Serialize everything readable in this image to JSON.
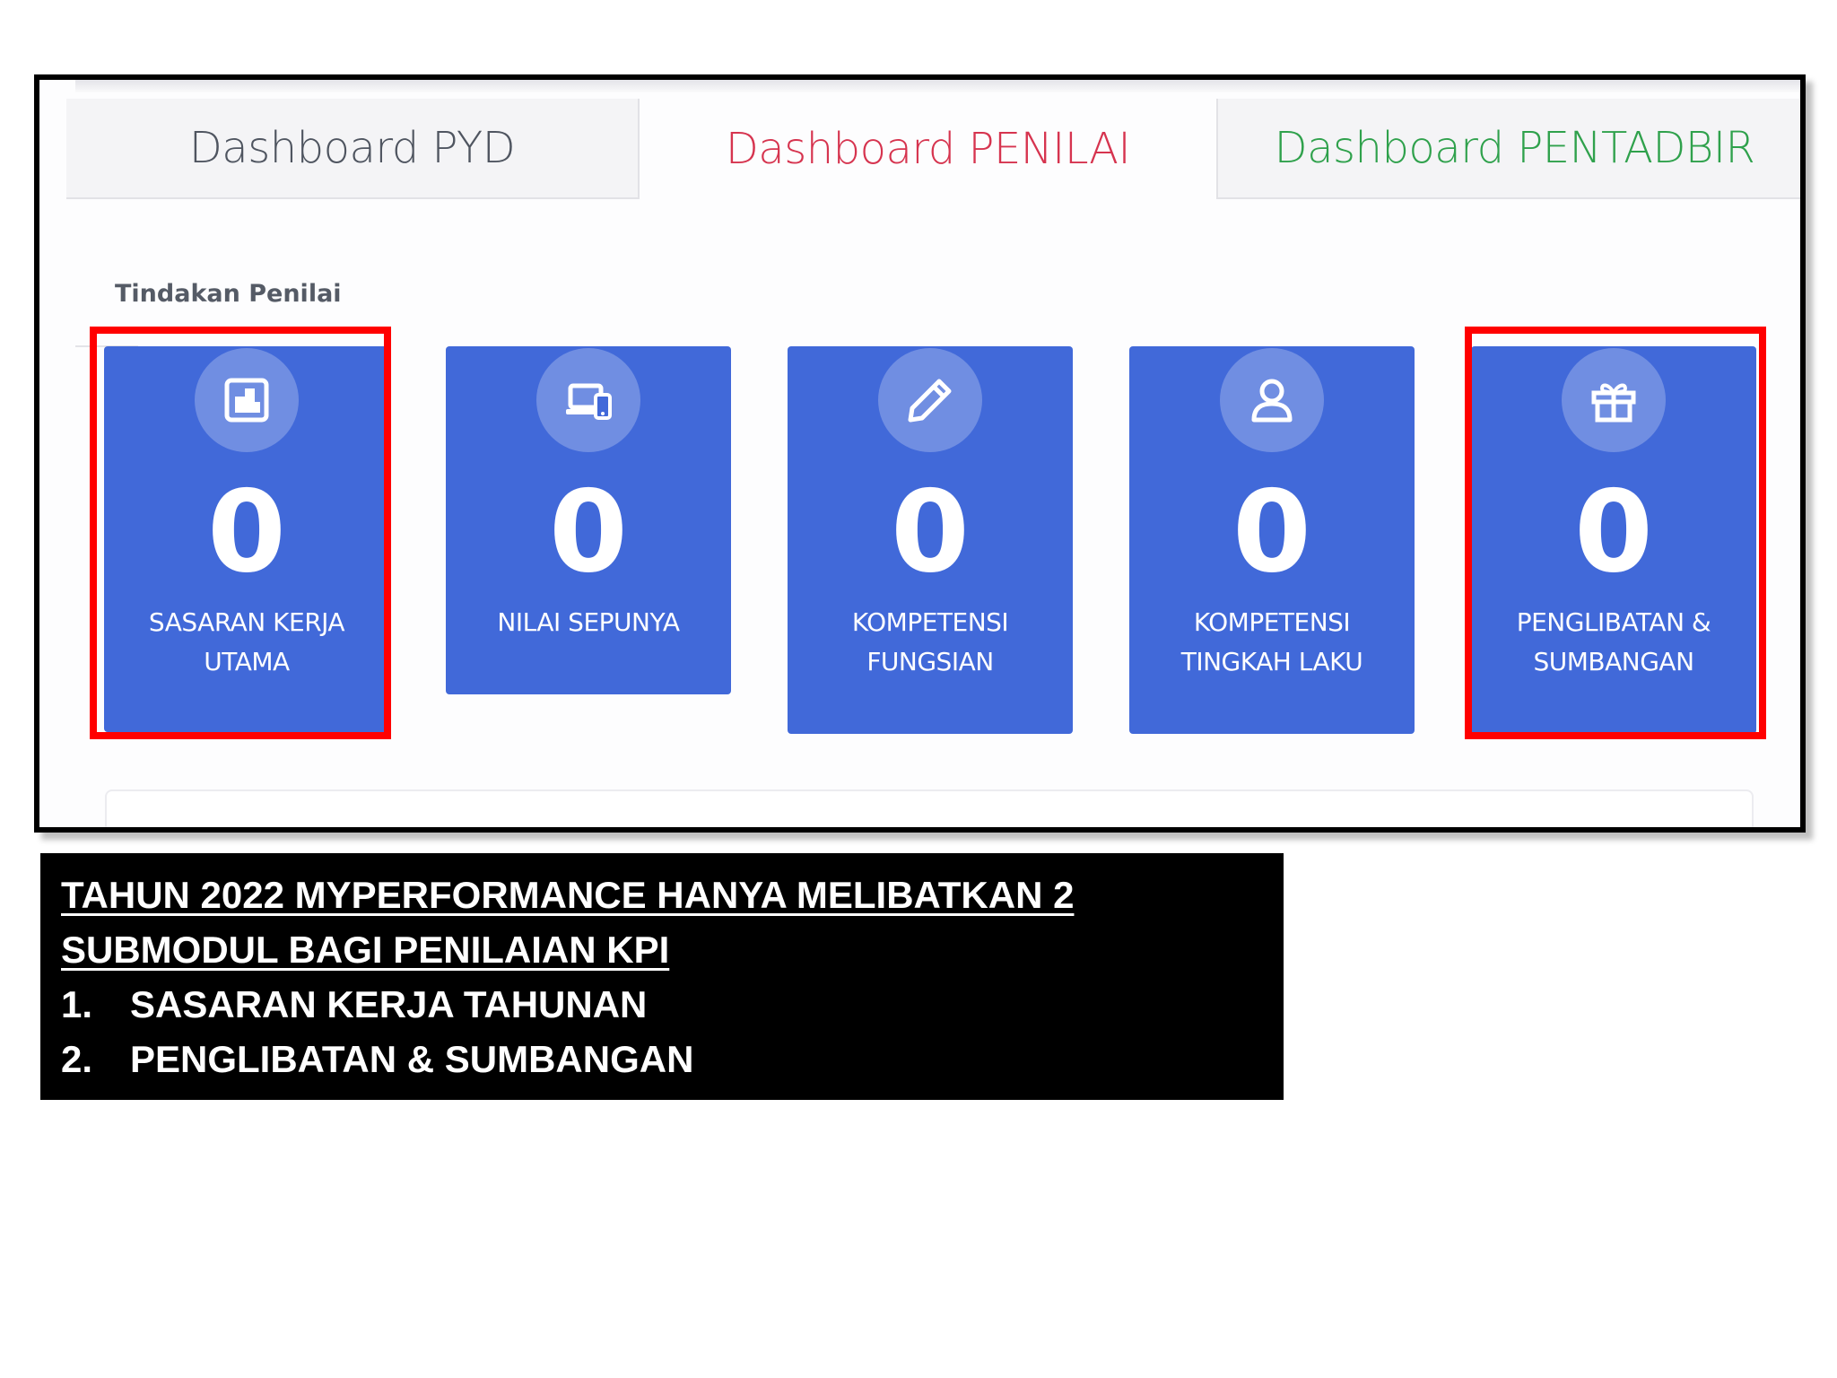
{
  "tabs": [
    {
      "label": "Dashboard PYD",
      "color": "#4f5560"
    },
    {
      "label": "Dashboard PENILAI",
      "color": "#d6344f",
      "active": true
    },
    {
      "label": "Dashboard PENTADBIR",
      "color": "#2fa14c"
    }
  ],
  "section_title": "Tindakan Penilai",
  "cards": [
    {
      "icon": "chart-icon",
      "count": "0",
      "label": "SASARAN KERJA\nUTAMA",
      "highlighted": true
    },
    {
      "icon": "devices-icon",
      "count": "0",
      "label": "NILAI SEPUNYA",
      "highlighted": false
    },
    {
      "icon": "pencil-icon",
      "count": "0",
      "label": "KOMPETENSI\nFUNGSIAN",
      "highlighted": false
    },
    {
      "icon": "user-icon",
      "count": "0",
      "label": "KOMPETENSI\nTINGKAH LAKU",
      "highlighted": false
    },
    {
      "icon": "gift-icon",
      "count": "0",
      "label": "PENGLIBATAN &\nSUMBANGAN",
      "highlighted": true
    }
  ],
  "caption": {
    "heading_line1": "TAHUN 2022 MYPERFORMANCE HANYA MELIBATKAN 2",
    "heading_line2": "SUBMODUL BAGI PENILAIAN KPI",
    "items": [
      {
        "num": "1.",
        "text": "SASARAN KERJA TAHUNAN"
      },
      {
        "num": "2.",
        "text": "PENGLIBATAN & SUMBANGAN"
      }
    ]
  },
  "colors": {
    "card_bg": "#4169d9",
    "highlight": "#ff0000",
    "tab_active": "#d6344f",
    "tab_pentadbir": "#2fa14c"
  }
}
